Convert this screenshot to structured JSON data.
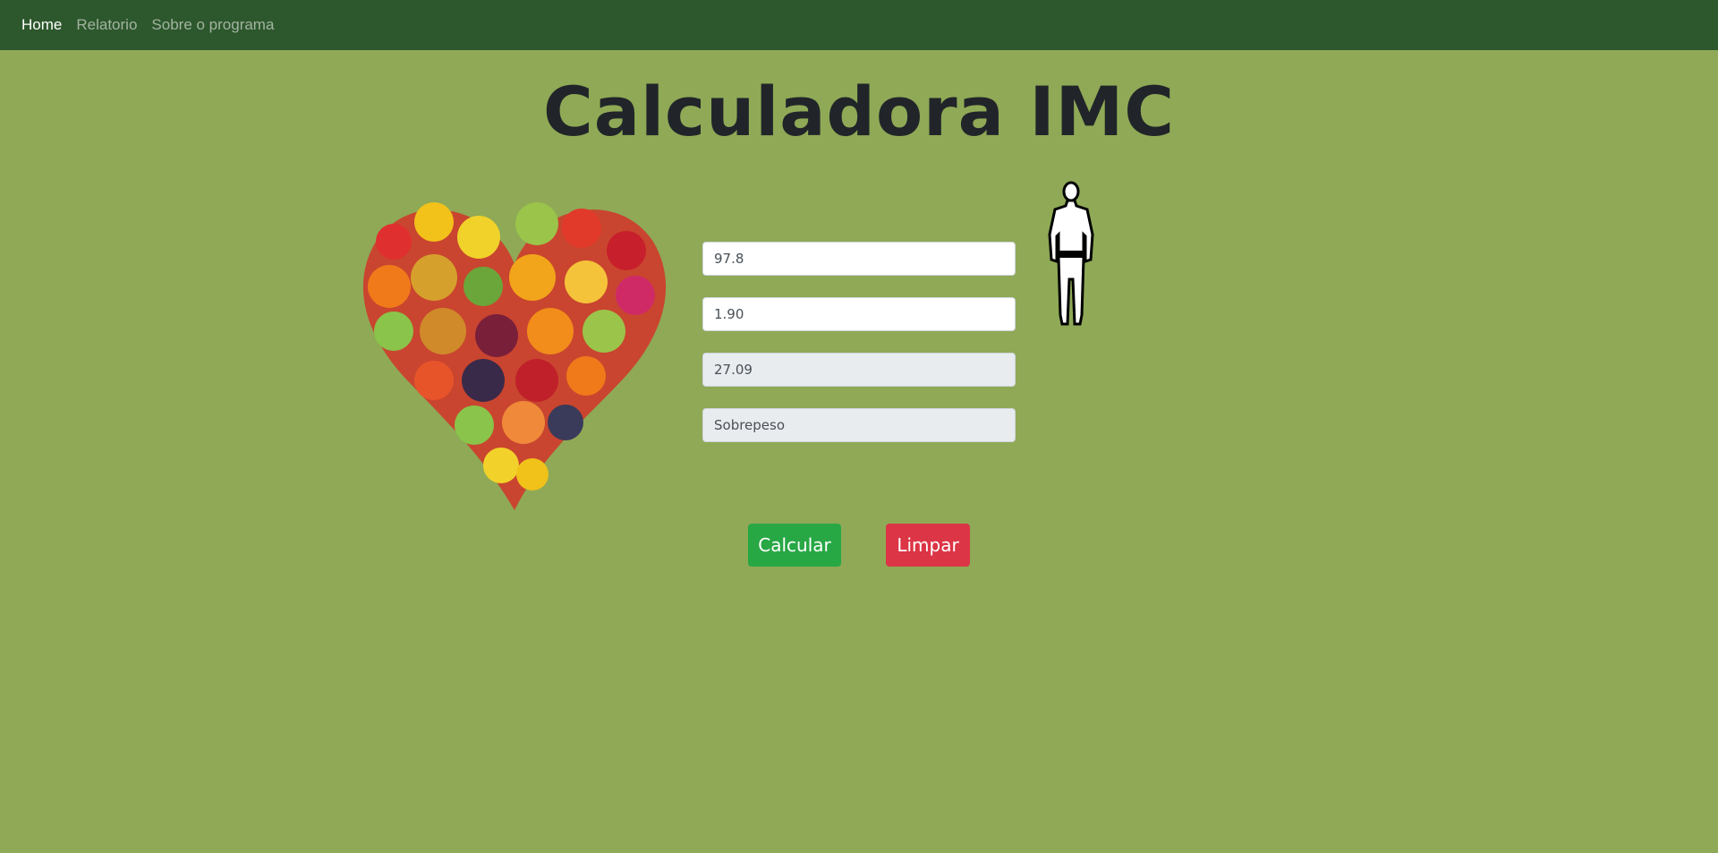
{
  "nav": {
    "items": [
      {
        "label": "Home",
        "active": true
      },
      {
        "label": "Relatorio",
        "active": false
      },
      {
        "label": "Sobre o programa",
        "active": false
      }
    ]
  },
  "page": {
    "title": "Calculadora IMC"
  },
  "form": {
    "peso": "97.8",
    "altura": "1.90",
    "imc": "27.09",
    "classificacao": "Sobrepeso"
  },
  "buttons": {
    "calcular": "Calcular",
    "limpar": "Limpar"
  },
  "colors": {
    "navbar": "#2d572c",
    "background": "#8fa956",
    "calcular": "#28a745",
    "limpar": "#dc3545"
  },
  "images": {
    "left": "fruit-heart-image",
    "right": "human-body-silhouette"
  }
}
